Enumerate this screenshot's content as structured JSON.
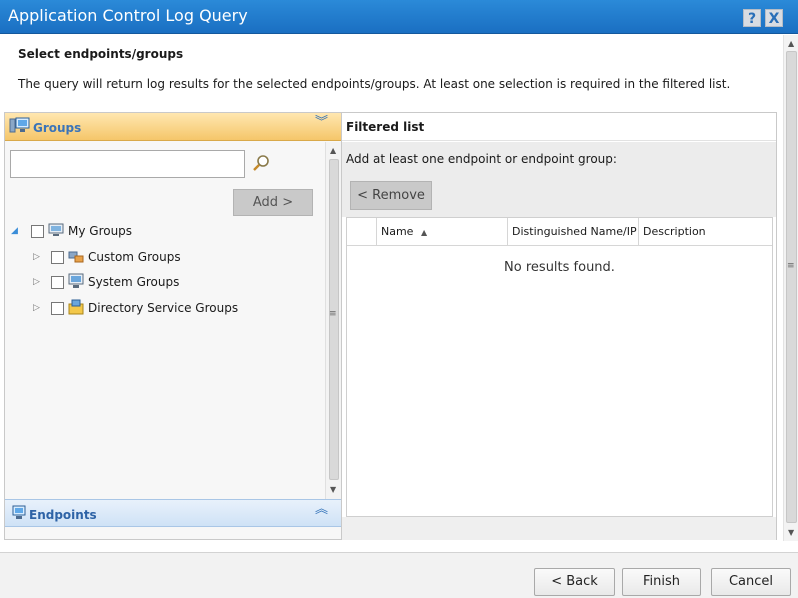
{
  "window": {
    "title": "Application Control Log Query",
    "help_glyph": "?",
    "close_glyph": "X"
  },
  "intro": {
    "heading": "Select endpoints/groups",
    "description": "The query will return log results for the selected endpoints/groups. At least one selection is required in the filtered list."
  },
  "groups_panel": {
    "title": "Groups",
    "search": {
      "value": "",
      "placeholder": ""
    },
    "add_label": "Add >",
    "tree": [
      {
        "label": "My Groups",
        "checked": false,
        "expanded": true
      },
      {
        "label": "Custom Groups",
        "checked": false,
        "expanded": false
      },
      {
        "label": "System Groups",
        "checked": false,
        "expanded": false
      },
      {
        "label": "Directory Service Groups",
        "checked": false,
        "expanded": false
      }
    ]
  },
  "endpoints_panel": {
    "title": "Endpoints"
  },
  "filtered_list": {
    "title": "Filtered list",
    "instruction": "Add at least one endpoint or endpoint group:",
    "remove_label": "< Remove",
    "columns": [
      "Name",
      "Distinguished Name/IP",
      "Description"
    ],
    "sort_indicator": "▲",
    "empty_message": "No results found."
  },
  "footer": {
    "back_label": "< Back",
    "finish_label": "Finish",
    "cancel_label": "Cancel"
  },
  "colors": {
    "titlebar": "#1a6fc2",
    "groups_header": "#f5c66a",
    "endpoints_header": "#cfe2f6",
    "accent_text": "#2e63a6"
  }
}
